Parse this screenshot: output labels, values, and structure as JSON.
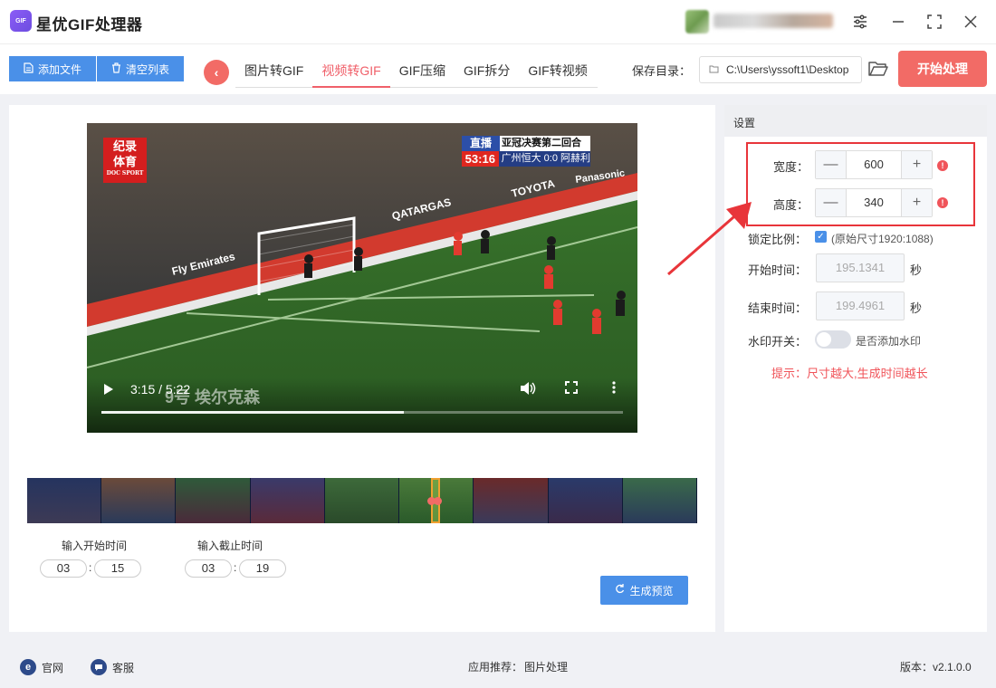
{
  "app": {
    "title": "星优GIF处理器",
    "logo_text": "GIF"
  },
  "window": {
    "settings_icon": "sliders-icon",
    "minimize_icon": "minimize-icon",
    "maximize_icon": "maximize-icon",
    "close_icon": "close-icon"
  },
  "toolbar": {
    "add_file_label": "添加文件",
    "clear_list_label": "清空列表",
    "tabs": [
      {
        "label": "图片转GIF",
        "active": false
      },
      {
        "label": "视频转GIF",
        "active": true
      },
      {
        "label": "GIF压缩",
        "active": false
      },
      {
        "label": "GIF拆分",
        "active": false
      },
      {
        "label": "GIF转视频",
        "active": false
      }
    ],
    "save_dir_label": "保存目录：",
    "save_dir_value": "C:\\Users\\yssoft1\\Desktop",
    "start_label": "开始处理"
  },
  "video": {
    "channel_logo_line1": "纪录",
    "channel_logo_line2": "体育",
    "channel_logo_sub": "DOC SPORT",
    "live_label": "直播",
    "match_title": "亚冠决赛第二回合",
    "match_clock": "53:16",
    "match_score": "广州恒大 0:0 阿赫利",
    "caption": "9号  埃尔克森",
    "time_display": "3:15 / 5:22",
    "progress": 0.58
  },
  "range": {
    "start_label": "输入开始时间",
    "end_label": "输入截止时间",
    "start_min": "03",
    "start_sec": "15",
    "end_min": "03",
    "end_sec": "19",
    "colon": ":",
    "preview_label": "生成预览"
  },
  "settings": {
    "header": "设置",
    "width_label": "宽度：",
    "width_value": "600",
    "height_label": "高度：",
    "height_value": "340",
    "lock_label": "锁定比例：",
    "lock_checked": true,
    "lock_text": "(原始尺寸1920:1088)",
    "start_time_label": "开始时间：",
    "start_time_value": "195.1341",
    "end_time_label": "结束时间：",
    "end_time_value": "199.4961",
    "seconds_unit": "秒",
    "watermark_label": "水印开关：",
    "watermark_text": "是否添加水印",
    "watermark_on": false,
    "tip": "提示：尺寸越大,生成时间越长",
    "minus": "—",
    "plus": "+"
  },
  "status": {
    "website_label": "官网",
    "service_label": "客服",
    "recommend_label": "应用推荐：",
    "recommend_value": "图片处理",
    "version_label": "版本：",
    "version_value": "v2.1.0.0"
  },
  "colors": {
    "accent": "#f26b66",
    "primary": "#4a90e8",
    "highlight": "#e8353a"
  }
}
